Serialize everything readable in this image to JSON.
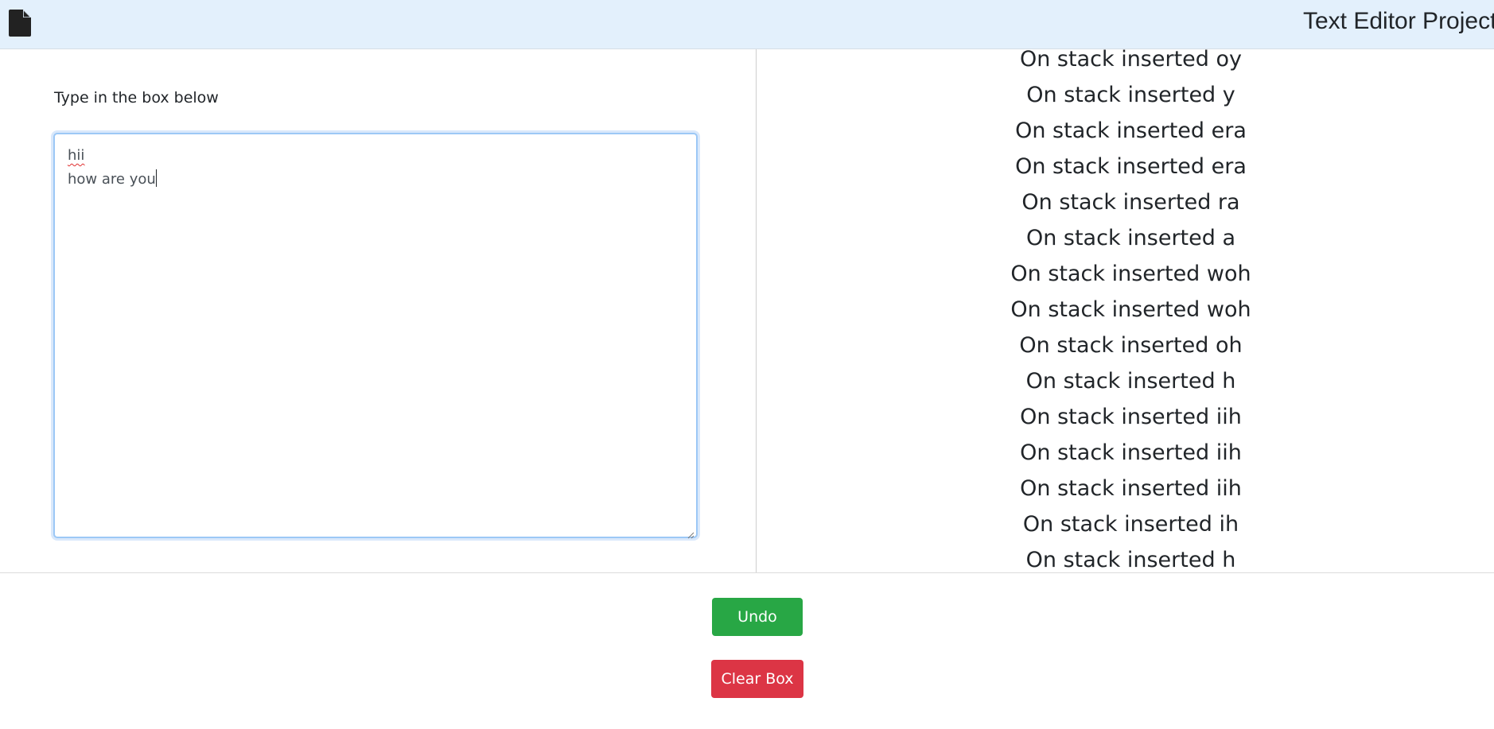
{
  "navbar": {
    "title": "Text Editor Project",
    "icon": "file-icon"
  },
  "editor": {
    "label": "Type in the box below",
    "lines": [
      "hii",
      "how are you"
    ]
  },
  "stack_log": {
    "items": [
      "On stack inserted oy",
      "On stack inserted y",
      "On stack inserted era",
      "On stack inserted era",
      "On stack inserted ra",
      "On stack inserted a",
      "On stack inserted woh",
      "On stack inserted woh",
      "On stack inserted oh",
      "On stack inserted h",
      "On stack inserted iih",
      "On stack inserted iih",
      "On stack inserted iih",
      "On stack inserted ih",
      "On stack inserted h"
    ]
  },
  "actions": {
    "undo_label": "Undo",
    "clear_label": "Clear Box"
  },
  "colors": {
    "navbar_bg": "#e3f0fc",
    "undo": "#28a745",
    "clear": "#dc3545",
    "focus_border": "#9cc8f6"
  }
}
